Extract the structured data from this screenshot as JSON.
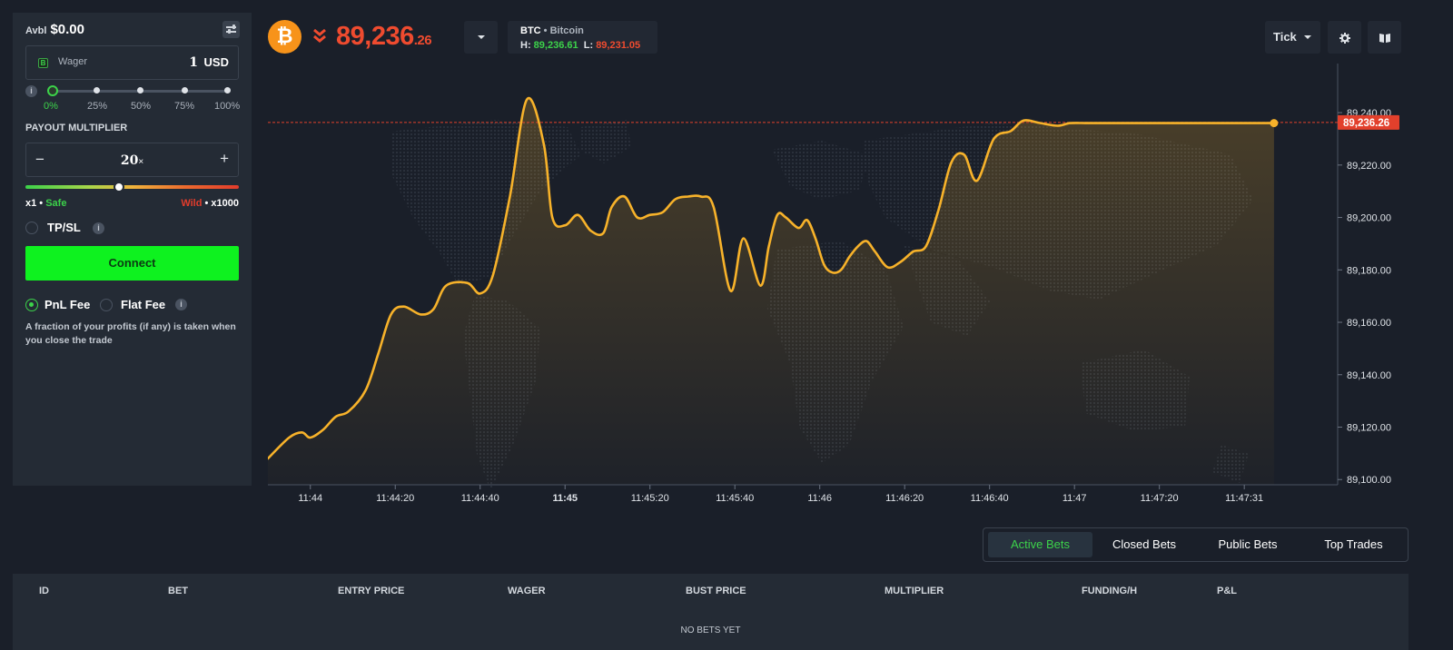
{
  "sidebar": {
    "avbl_label": "Avbl",
    "avbl_amount": "$0.00",
    "wager": {
      "icon_letter": "B",
      "label": "Wager",
      "value": "1",
      "currency": "USD"
    },
    "wager_percent_labels": [
      "0%",
      "25%",
      "50%",
      "75%",
      "100%"
    ],
    "wager_percent_selected": 0,
    "payout_title": "PAYOUT MULTIPLIER",
    "multiplier": {
      "minus": "−",
      "value": "20",
      "suffix": "×",
      "plus": "+"
    },
    "risk": {
      "min": "x1",
      "safe": "Safe",
      "wild": "Wild",
      "max": "x1000",
      "level": 0.44
    },
    "tpsl_label": "TP/SL",
    "info_glyph": "i",
    "connect_label": "Connect",
    "fee_pnl_label": "PnL Fee",
    "fee_flat_label": "Flat Fee",
    "fee_selected": "pnl",
    "fee_description": "A fraction of your profits (if any) is taken when you close the trade"
  },
  "header": {
    "logo_glyph": "₿",
    "price_main": "89,236",
    "price_decimal": ".26",
    "asset_symbol": "BTC",
    "asset_separator": "•",
    "asset_name": "Bitcoin",
    "high_label": "H:",
    "high_value": "89,236.61",
    "low_label": "L:",
    "low_value": "89,231.05",
    "interval_label": "Tick",
    "settings_icon": "gear-icon",
    "layout_icon": "book-icon",
    "colors": {
      "down": "#ef4b2f",
      "up": "#3cd24a",
      "btc": "#f7931a"
    }
  },
  "chart_data": {
    "type": "line",
    "x_tick_labels": [
      "11:44",
      "11:44:20",
      "11:44:40",
      "11:45",
      "11:45:20",
      "11:45:40",
      "11:46",
      "11:46:20",
      "11:46:40",
      "11:47",
      "11:47:20",
      "11:47:31"
    ],
    "x_tick_seconds": [
      0,
      20,
      40,
      60,
      80,
      100,
      120,
      140,
      160,
      180,
      200,
      220
    ],
    "x_range": [
      -10,
      242
    ],
    "y_tick_labels": [
      "89,100.00",
      "89,120.00",
      "89,140.00",
      "89,160.00",
      "89,180.00",
      "89,200.00",
      "89,220.00",
      "89,240.00"
    ],
    "y_ticks": [
      89100,
      89120,
      89140,
      89160,
      89180,
      89200,
      89220,
      89240
    ],
    "y_range": [
      89098,
      89257
    ],
    "current_price": 89236.26,
    "current_price_label": "89,236.26",
    "line_color": "#f7b22a",
    "series": [
      {
        "x": [
          -10,
          -5,
          -2,
          0,
          3,
          6,
          9,
          13,
          16,
          19,
          22,
          26,
          29,
          32,
          37,
          40,
          43,
          47,
          51,
          55,
          57,
          60,
          63,
          66,
          69,
          71,
          74,
          77,
          80,
          83,
          86,
          89,
          92,
          95,
          99,
          102,
          106,
          108,
          110,
          112,
          115,
          117,
          119,
          121,
          123,
          125,
          127,
          129,
          131,
          133,
          136,
          139,
          142,
          145,
          148,
          151,
          154,
          157,
          161,
          165,
          168,
          172,
          176,
          179,
          183,
          187,
          190,
          193,
          196,
          199,
          201,
          204,
          207,
          211,
          215,
          218,
          222,
          225,
          227
        ],
        "y": [
          89108,
          89116,
          89118,
          89116,
          89119,
          89124,
          89126,
          89134,
          89148,
          89163,
          89166,
          89163,
          89165,
          89174,
          89175,
          89171,
          89178,
          89208,
          89245,
          89228,
          89200,
          89197,
          89201,
          89195,
          89194,
          89204,
          89208,
          89200,
          89201,
          89202,
          89207,
          89208,
          89208,
          89204,
          89172,
          89192,
          89174,
          89189,
          89201,
          89200,
          89196,
          89199,
          89192,
          89182,
          89179,
          89180,
          89185,
          89189,
          89191,
          89187,
          89181,
          89183,
          89187,
          89189,
          89203,
          89221,
          89224,
          89214,
          89230,
          89233,
          89237,
          89236,
          89235,
          89236,
          89236,
          89236,
          89236,
          89236,
          89236,
          89236,
          89236,
          89236,
          89236,
          89236,
          89236,
          89236,
          89236,
          89236,
          89236
        ]
      }
    ]
  },
  "tabs": [
    "Active Bets",
    "Closed Bets",
    "Public Bets",
    "Top Trades"
  ],
  "tabs_active": 0,
  "table": {
    "columns": [
      "ID",
      "BET",
      "ENTRY PRICE",
      "WAGER",
      "BUST PRICE",
      "MULTIPLIER",
      "FUNDING/H",
      "P&L"
    ],
    "empty_text": "NO BETS YET"
  }
}
